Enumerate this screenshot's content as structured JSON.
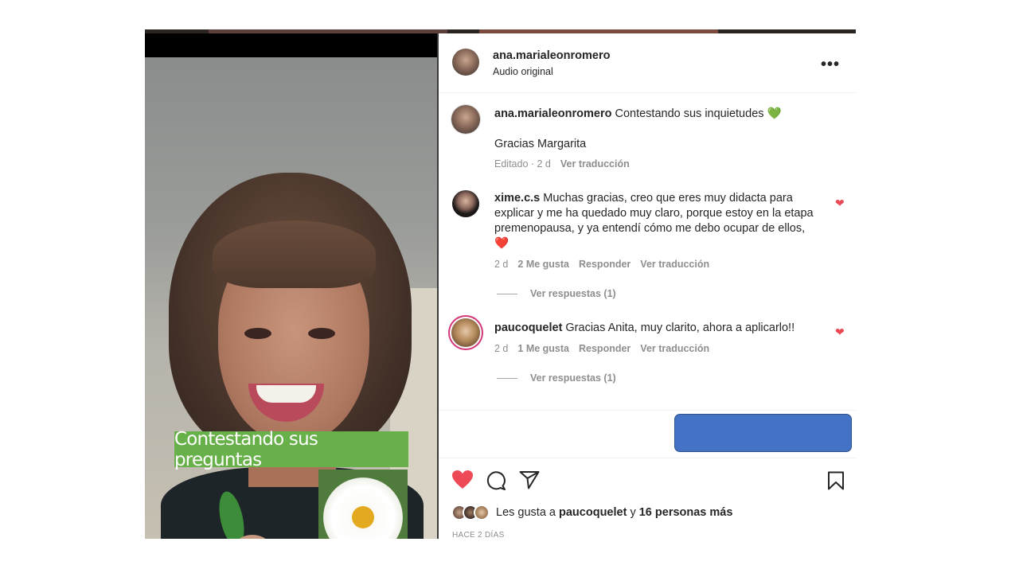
{
  "video": {
    "caption": "Contestando sus preguntas"
  },
  "header": {
    "username": "ana.marialeonromero",
    "subtitle": "Audio original",
    "more_icon": "more-horizontal-icon",
    "more_label": "..."
  },
  "caption_post": {
    "username": "ana.marialeonromero",
    "text": "Contestando sus inquietudes",
    "emoji": "💚",
    "second_line": "Gracias Margarita",
    "meta": "Editado · 2 d",
    "translate": "Ver traducción"
  },
  "comments": [
    {
      "username": "xime.c.s",
      "text": "Muchas gracias, creo que eres muy didacta para explicar y me ha quedado muy claro, porque estoy en la etapa premenopausa, y ya entendí cómo me debo ocupar de ellos,",
      "emoji": "❤️",
      "time": "2 d",
      "likes": "2 Me gusta",
      "reply": "Responder",
      "translate": "Ver traducción",
      "replies": "Ver respuestas (1)",
      "liked": true
    },
    {
      "username": "paucoquelet",
      "text": "Gracias Anita, muy clarito, ahora a aplicarlo!!",
      "time": "2 d",
      "likes": "1 Me gusta",
      "reply": "Responder",
      "translate": "Ver traducción",
      "replies": "Ver respuestas (1)",
      "liked": true
    }
  ],
  "actions": {
    "like_icon": "heart-filled-icon",
    "comment_icon": "comment-icon",
    "share_icon": "send-icon",
    "save_icon": "bookmark-icon"
  },
  "likes": {
    "prefix": "Les gusta a",
    "user": "paucoquelet",
    "joiner": "y",
    "others": "16 personas más"
  },
  "date": "HACE 2 DÍAS",
  "colors": {
    "like_red": "#ed4956",
    "blue_box": "#4472c4",
    "caption_green": "#68b04a"
  }
}
